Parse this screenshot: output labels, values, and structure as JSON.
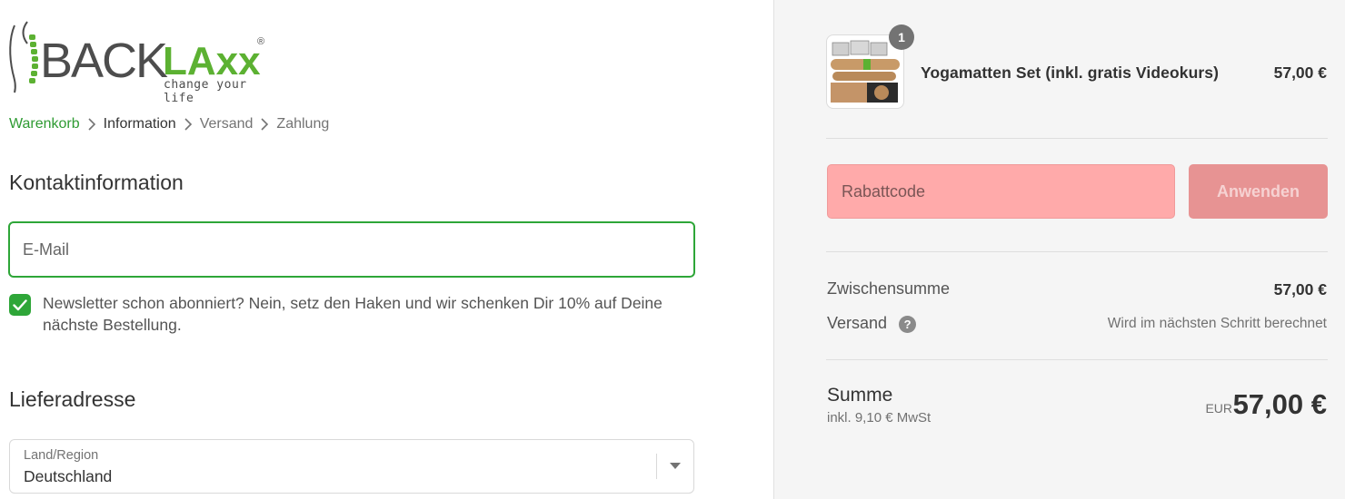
{
  "brand": {
    "logo_back": "BACK",
    "logo_laxx": "LAxx",
    "logo_registered": "®",
    "tagline": "change your life",
    "accent_color": "#5cb132"
  },
  "breadcrumb": {
    "items": [
      {
        "label": "Warenkorb",
        "state": "link"
      },
      {
        "label": "Information",
        "state": "current"
      },
      {
        "label": "Versand",
        "state": "upcoming"
      },
      {
        "label": "Zahlung",
        "state": "upcoming"
      }
    ],
    "separator_icon": "chevron-right-icon"
  },
  "contact": {
    "title": "Kontaktinformation",
    "email_placeholder": "E-Mail",
    "email_value": "",
    "newsletter_checked": true,
    "newsletter_text": "Newsletter schon abonniert? Nein, setz den Haken und wir schenken Dir 10% auf Deine nächste Bestellung."
  },
  "shipping": {
    "title": "Lieferadresse",
    "country_label": "Land/Region",
    "country_value": "Deutschland"
  },
  "summary": {
    "product": {
      "name": "Yogamatten Set (inkl. gratis Videokurs)",
      "price": "57,00 €",
      "quantity": "1"
    },
    "discount_placeholder": "Rabattcode",
    "apply_label": "Anwenden",
    "subtotal_label": "Zwischensumme",
    "subtotal_value": "57,00 €",
    "shipping_label": "Versand",
    "shipping_value": "Wird im nächsten Schritt berechnet",
    "total_label": "Summe",
    "tax_note": "inkl. 9,10 € MwSt",
    "currency": "EUR",
    "total_value": "57,00 €"
  },
  "colors": {
    "primary_green": "#2ea638",
    "discount_bg": "#ffaaaa",
    "apply_bg": "#e79393",
    "sidebar_bg": "#f5f5f5"
  }
}
